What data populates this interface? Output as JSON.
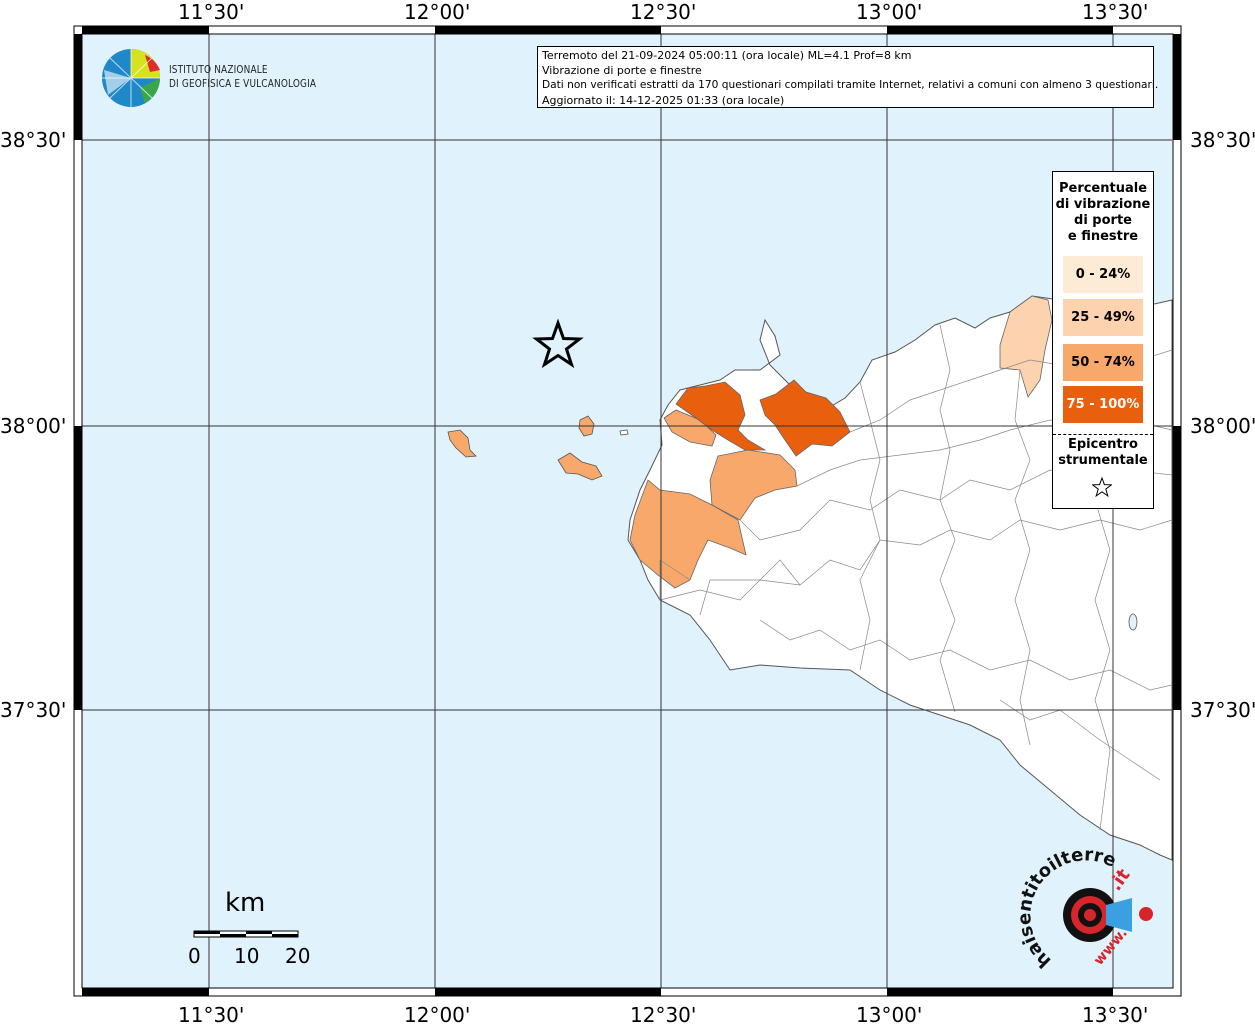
{
  "map": {
    "axis_labels": {
      "top": [
        "11°30'",
        "12°00'",
        "12°30'",
        "13°00'",
        "13°30'"
      ],
      "bottom": [
        "11°30'",
        "12°00'",
        "12°30'",
        "13°00'",
        "13°30'"
      ],
      "left": [
        "38°30'",
        "38°00'",
        "37°30'"
      ],
      "right": [
        "38°30'",
        "38°00'",
        "37°30'"
      ]
    },
    "colors": {
      "sea": "#e0f2fc",
      "land": "#ffffff",
      "border": "#000000",
      "class_0_24": "#fdebd6",
      "class_25_49": "#fdd2ae",
      "class_50_74": "#f8a86a",
      "class_75_100": "#e85f0e"
    },
    "epicenter_symbol": "star-outline"
  },
  "logo": {
    "line1": "ISTITUTO NAZIONALE",
    "line2": "DI GEOFISICA E VULCANOLOGIA"
  },
  "info": {
    "line1": "Terremoto del 21-09-2024 05:00:11 (ora locale) ML=4.1 Prof=8 km",
    "line2": "Vibrazione di porte e finestre",
    "line3": "Dati non verificati estratti da 170 questionari compilati tramite Internet, relativi a comuni con almeno 3 questionari.",
    "line4": "Aggiornato il: 14-12-2025 01:33 (ora locale)"
  },
  "legend": {
    "title_lines": [
      "Percentuale",
      "di vibrazione",
      "di porte",
      "e finestre"
    ],
    "items": [
      {
        "label": "0 - 24%",
        "color": "#fdebd6",
        "text_color": "#000000"
      },
      {
        "label": "25 - 49%",
        "color": "#fdd2ae",
        "text_color": "#000000"
      },
      {
        "label": "50 - 74%",
        "color": "#f8a86a",
        "text_color": "#000000"
      },
      {
        "label": "75 - 100%",
        "color": "#e85f0e",
        "text_color": "#ffffff"
      }
    ],
    "epicenter_lines": [
      "Epicentro",
      "strumentale"
    ],
    "epicenter_icon": "star-icon"
  },
  "scalebar": {
    "unit": "km",
    "ticks": [
      "0",
      "10",
      "20"
    ]
  },
  "brand": {
    "text_left": "haisentitoilterremoto",
    "text_right": ".it",
    "text_bottom": "www."
  }
}
